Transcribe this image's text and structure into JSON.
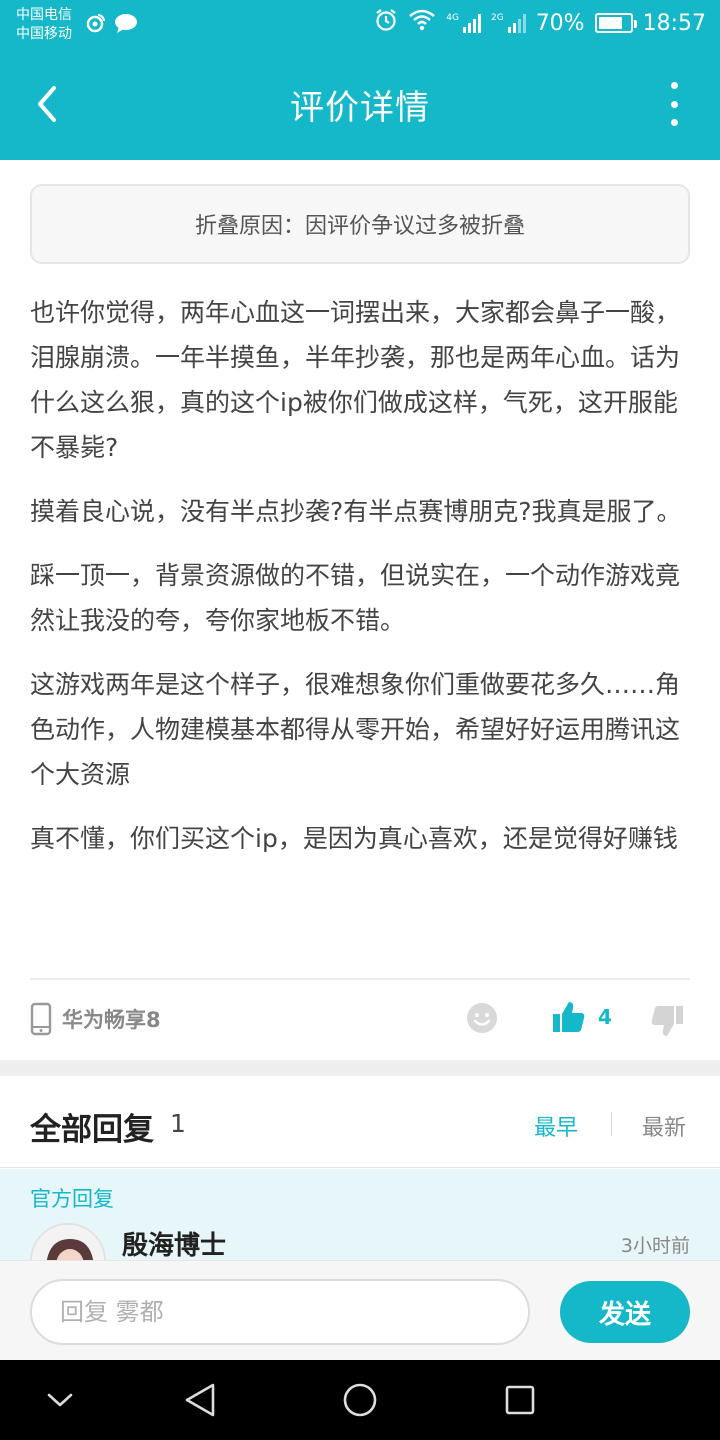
{
  "status_bar": {
    "carrier1": "中国电信",
    "carrier2": "中国移动",
    "network1": "4G",
    "network2": "2G",
    "battery": "70%",
    "time": "18:57"
  },
  "app_bar": {
    "title": "评价详情",
    "back_icon": "chevron-left-icon",
    "more_icon": "more-vertical-icon"
  },
  "fold_notice": "折叠原因：因评价争议过多被折叠",
  "review": {
    "paragraphs": [
      "也许你觉得，两年心血这一词摆出来，大家都会鼻子一酸，泪腺崩溃。一年半摸鱼，半年抄袭，那也是两年心血。话为什么这么狠，真的这个ip被你们做成这样，气死，这开服能不暴毙?",
      "摸着良心说，没有半点抄袭?有半点赛博朋克?我真是服了。",
      "踩一顶一，背景资源做的不错，但说实在，一个动作游戏竟然让我没的夸，夸你家地板不错。",
      "这游戏两年是这个样子，很难想象你们重做要花多久……角色动作，人物建模基本都得从零开始，希望好好运用腾讯这个大资源",
      "真不懂，你们买这个ip，是因为真心喜欢，还是觉得好赚钱"
    ],
    "device": "华为畅享8",
    "like_count": "4"
  },
  "replies": {
    "title": "全部回复",
    "count": "1",
    "sort_earliest": "最早",
    "sort_latest": "最新",
    "official_label": "官方回复",
    "first_reply": {
      "author": "殷海博士",
      "time": "3小时前"
    }
  },
  "compose": {
    "placeholder": "回复 雾都",
    "send_label": "发送"
  },
  "colors": {
    "accent": "#14b8c8",
    "official_bg": "#e7f6f8"
  }
}
